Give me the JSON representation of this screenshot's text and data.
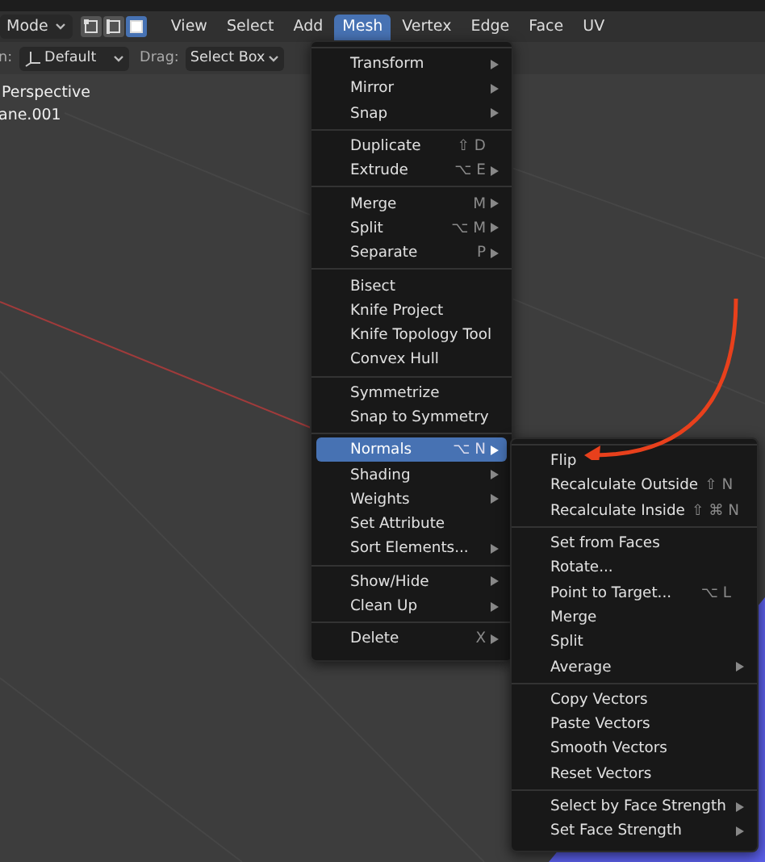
{
  "header": {
    "mode_dropdown": "Mode",
    "select_modes": [
      {
        "kind": "vertex",
        "selected": false
      },
      {
        "kind": "edge",
        "selected": false
      },
      {
        "kind": "face",
        "selected": true
      }
    ],
    "menus": [
      {
        "label": "View",
        "selected": false
      },
      {
        "label": "Select",
        "selected": false
      },
      {
        "label": "Add",
        "selected": false
      },
      {
        "label": "Mesh",
        "selected": true
      },
      {
        "label": "Vertex",
        "selected": false
      },
      {
        "label": "Edge",
        "selected": false
      },
      {
        "label": "Face",
        "selected": false
      },
      {
        "label": "UV",
        "selected": false
      }
    ]
  },
  "tool_settings": {
    "orientation_label": "n:",
    "orientation_value": "Default",
    "drag_label": "Drag:",
    "drag_value": "Select Box"
  },
  "viewport": {
    "view_name": "Perspective",
    "object_name": "ane.001"
  },
  "mesh_menu": {
    "sections": [
      [
        {
          "label": "Transform",
          "submenu": true,
          "selected": false
        },
        {
          "label": "Mirror",
          "submenu": true,
          "selected": false
        },
        {
          "label": "Snap",
          "submenu": true,
          "selected": false
        }
      ],
      [
        {
          "label": "Duplicate",
          "shortcut": "⇧ D",
          "submenu": false,
          "selected": false
        },
        {
          "label": "Extrude",
          "shortcut": "⌥ E",
          "submenu": true,
          "selected": false
        }
      ],
      [
        {
          "label": "Merge",
          "shortcut": "M",
          "submenu": true,
          "selected": false
        },
        {
          "label": "Split",
          "shortcut": "⌥ M",
          "submenu": true,
          "selected": false
        },
        {
          "label": "Separate",
          "shortcut": "P",
          "submenu": true,
          "selected": false
        }
      ],
      [
        {
          "label": "Bisect",
          "submenu": false,
          "selected": false
        },
        {
          "label": "Knife Project",
          "submenu": false,
          "selected": false
        },
        {
          "label": "Knife Topology Tool",
          "submenu": false,
          "selected": false
        },
        {
          "label": "Convex Hull",
          "submenu": false,
          "selected": false
        }
      ],
      [
        {
          "label": "Symmetrize",
          "submenu": false,
          "selected": false
        },
        {
          "label": "Snap to Symmetry",
          "submenu": false,
          "selected": false
        }
      ],
      [
        {
          "label": "Normals",
          "shortcut": "⌥ N",
          "submenu": true,
          "selected": true
        },
        {
          "label": "Shading",
          "submenu": true,
          "selected": false
        },
        {
          "label": "Weights",
          "submenu": true,
          "selected": false
        },
        {
          "label": "Set Attribute",
          "submenu": false,
          "selected": false
        },
        {
          "label": "Sort Elements...",
          "submenu": true,
          "selected": false
        }
      ],
      [
        {
          "label": "Show/Hide",
          "submenu": true,
          "selected": false
        },
        {
          "label": "Clean Up",
          "submenu": true,
          "selected": false
        }
      ],
      [
        {
          "label": "Delete",
          "shortcut": "X",
          "submenu": true,
          "selected": false
        }
      ]
    ]
  },
  "normals_menu": {
    "sections": [
      [
        {
          "label": "Flip",
          "submenu": false,
          "selected": false
        },
        {
          "label": "Recalculate Outside",
          "shortcut": "⇧ N",
          "submenu": false,
          "selected": false
        },
        {
          "label": "Recalculate Inside",
          "shortcut": "⇧ ⌘ N",
          "submenu": false,
          "selected": false
        }
      ],
      [
        {
          "label": "Set from Faces",
          "submenu": false,
          "selected": false
        },
        {
          "label": "Rotate...",
          "submenu": false,
          "selected": false
        },
        {
          "label": "Point to Target...",
          "shortcut": "⌥ L",
          "submenu": false,
          "selected": false
        },
        {
          "label": "Merge",
          "submenu": false,
          "selected": false
        },
        {
          "label": "Split",
          "submenu": false,
          "selected": false
        },
        {
          "label": "Average",
          "submenu": true,
          "selected": false
        }
      ],
      [
        {
          "label": "Copy Vectors",
          "submenu": false,
          "selected": false
        },
        {
          "label": "Paste Vectors",
          "submenu": false,
          "selected": false
        },
        {
          "label": "Smooth Vectors",
          "submenu": false,
          "selected": false
        },
        {
          "label": "Reset Vectors",
          "submenu": false,
          "selected": false
        }
      ],
      [
        {
          "label": "Select by Face Strength",
          "submenu": true,
          "selected": false
        },
        {
          "label": "Set Face Strength",
          "submenu": true,
          "selected": false
        }
      ]
    ]
  }
}
